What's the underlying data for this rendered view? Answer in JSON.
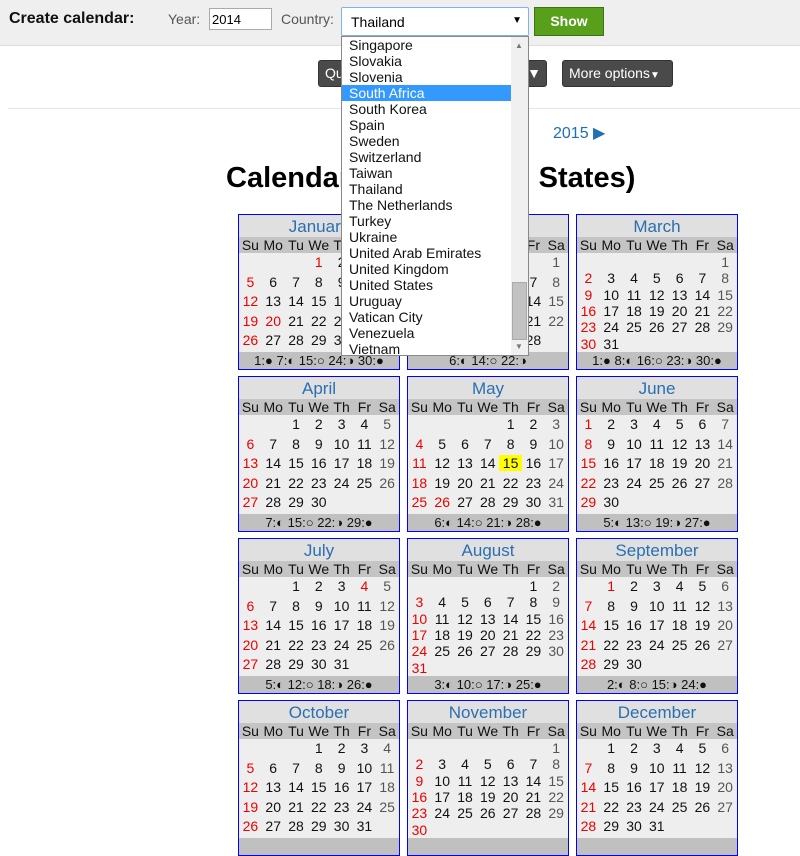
{
  "header": {
    "label": "Create calendar:",
    "year_label": "Year:",
    "year_value": "2014",
    "country_label": "Country:",
    "country_value": "Thailand",
    "show_label": "Show"
  },
  "toolbar": {
    "quick_label": "Quick options",
    "more_label": "More options"
  },
  "nav": {
    "next_year": "2015"
  },
  "page_title": "Calendar 2014 (United States)",
  "dropdown": {
    "items": [
      "Singapore",
      "Slovakia",
      "Slovenia",
      "South Africa",
      "South Korea",
      "Spain",
      "Sweden",
      "Switzerland",
      "Taiwan",
      "Thailand",
      "The Netherlands",
      "Turkey",
      "Ukraine",
      "United Arab Emirates",
      "United Kingdom",
      "United States",
      "Uruguay",
      "Vatican City",
      "Venezuela",
      "Vietnam"
    ],
    "highlighted": "South Africa"
  },
  "weekdays": [
    "Su",
    "Mo",
    "Tu",
    "We",
    "Th",
    "Fr",
    "Sa"
  ],
  "today": {
    "month": 5,
    "day": 15
  },
  "moon_icons": {
    "new": "●",
    "first_quarter": "◐",
    "full": "○",
    "last_quarter": "◑"
  },
  "colors": {
    "holiday": "#e00000",
    "month_title": "#2a6fb0",
    "border": "#0000ff",
    "today": "#ffff00",
    "show_button": "#58a01c"
  },
  "months": [
    {
      "name": "January",
      "start": 3,
      "days": 31,
      "holidays": [
        1,
        20
      ],
      "moons": [
        [
          1,
          "new"
        ],
        [
          7,
          "first_quarter"
        ],
        [
          15,
          "full"
        ],
        [
          24,
          "last_quarter"
        ],
        [
          30,
          "new"
        ]
      ]
    },
    {
      "name": "February",
      "start": 6,
      "days": 28,
      "holidays": [
        17
      ],
      "moons": [
        [
          6,
          "first_quarter"
        ],
        [
          14,
          "full"
        ],
        [
          22,
          "last_quarter"
        ]
      ]
    },
    {
      "name": "March",
      "start": 6,
      "days": 31,
      "holidays": [],
      "moons": [
        [
          1,
          "new"
        ],
        [
          8,
          "first_quarter"
        ],
        [
          16,
          "full"
        ],
        [
          23,
          "last_quarter"
        ],
        [
          30,
          "new"
        ]
      ]
    },
    {
      "name": "April",
      "start": 2,
      "days": 30,
      "holidays": [],
      "moons": [
        [
          7,
          "first_quarter"
        ],
        [
          15,
          "full"
        ],
        [
          22,
          "last_quarter"
        ],
        [
          29,
          "new"
        ]
      ]
    },
    {
      "name": "May",
      "start": 4,
      "days": 31,
      "holidays": [
        26
      ],
      "moons": [
        [
          6,
          "first_quarter"
        ],
        [
          14,
          "full"
        ],
        [
          21,
          "last_quarter"
        ],
        [
          28,
          "new"
        ]
      ]
    },
    {
      "name": "June",
      "start": 0,
      "days": 30,
      "holidays": [],
      "moons": [
        [
          5,
          "first_quarter"
        ],
        [
          13,
          "full"
        ],
        [
          19,
          "last_quarter"
        ],
        [
          27,
          "new"
        ]
      ]
    },
    {
      "name": "July",
      "start": 2,
      "days": 31,
      "holidays": [
        4
      ],
      "moons": [
        [
          5,
          "first_quarter"
        ],
        [
          12,
          "full"
        ],
        [
          18,
          "last_quarter"
        ],
        [
          26,
          "new"
        ]
      ]
    },
    {
      "name": "August",
      "start": 5,
      "days": 31,
      "holidays": [],
      "moons": [
        [
          3,
          "first_quarter"
        ],
        [
          10,
          "full"
        ],
        [
          17,
          "last_quarter"
        ],
        [
          25,
          "new"
        ]
      ]
    },
    {
      "name": "September",
      "start": 1,
      "days": 30,
      "holidays": [
        1
      ],
      "moons": [
        [
          2,
          "first_quarter"
        ],
        [
          8,
          "full"
        ],
        [
          15,
          "last_quarter"
        ],
        [
          24,
          "new"
        ]
      ]
    },
    {
      "name": "October",
      "start": 3,
      "days": 31,
      "holidays": [],
      "moons": []
    },
    {
      "name": "November",
      "start": 6,
      "days": 30,
      "holidays": [],
      "moons": []
    },
    {
      "name": "December",
      "start": 1,
      "days": 31,
      "holidays": [],
      "moons": []
    }
  ]
}
